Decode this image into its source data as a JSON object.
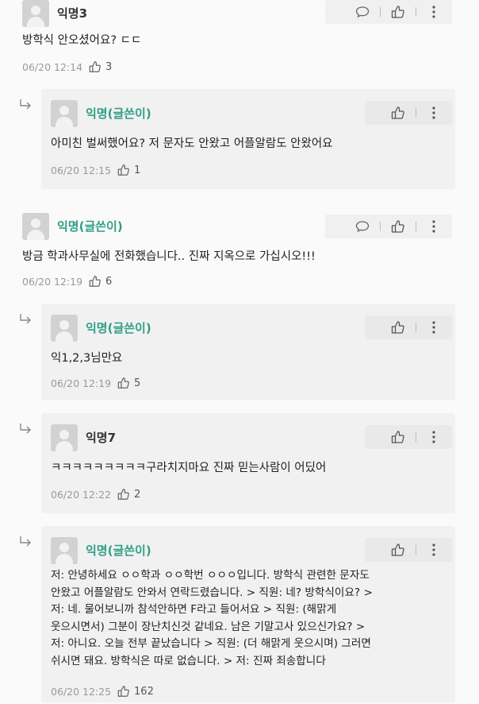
{
  "comments": [
    {
      "author": "익명3",
      "text": "방학식 안오셨어요? ㄷㄷ",
      "time": "06/20 12:14",
      "likes": "3"
    },
    {
      "author": "익명(글쓴이)",
      "text": "아미친 벌써했어요? 저 문자도 안왔고 어플알람도 안왔어요",
      "time": "06/20 12:15",
      "likes": "1"
    },
    {
      "author": "익명(글쓴이)",
      "text": "방금 학과사무실에 전화했습니다.. 진짜 지옥으로 가십시오!!!",
      "time": "06/20 12:19",
      "likes": "6"
    },
    {
      "author": "익명(글쓴이)",
      "text": "익1,2,3님만요",
      "time": "06/20 12:19",
      "likes": "5"
    },
    {
      "author": "익명7",
      "text": "ㅋㅋㅋㅋㅋㅋㅋㅋㅋ구라치지마요 진짜 믿는사람이 어딨어",
      "time": "06/20 12:22",
      "likes": "2"
    },
    {
      "author": "익명(글쓴이)",
      "lines": [
        "저: 안녕하세요 ㅇㅇ학과 ㅇㅇ학번 ㅇㅇㅇ입니다. 방학식 관련한 문자도",
        "안왔고 어플알람도 안와서 연락드렸습니다. > 직원: 네? 방학식이요? >",
        "저: 네. 물어보니까 참석안하면 F라고 들어서요 > 직원: (해맑게",
        "웃으시면서) 그분이 장난치신것 같네요. 남은 기말고사 있으신가요? >",
        "저: 아니요. 오늘 전부 끝났습니다 > 직원: (더 해맑게 웃으시며) 그러면",
        "쉬시면 돼요. 방학식은 따로 없습니다. > 저: 진짜 죄송합니다"
      ],
      "time": "06/20 12:25",
      "likes": "162"
    }
  ]
}
